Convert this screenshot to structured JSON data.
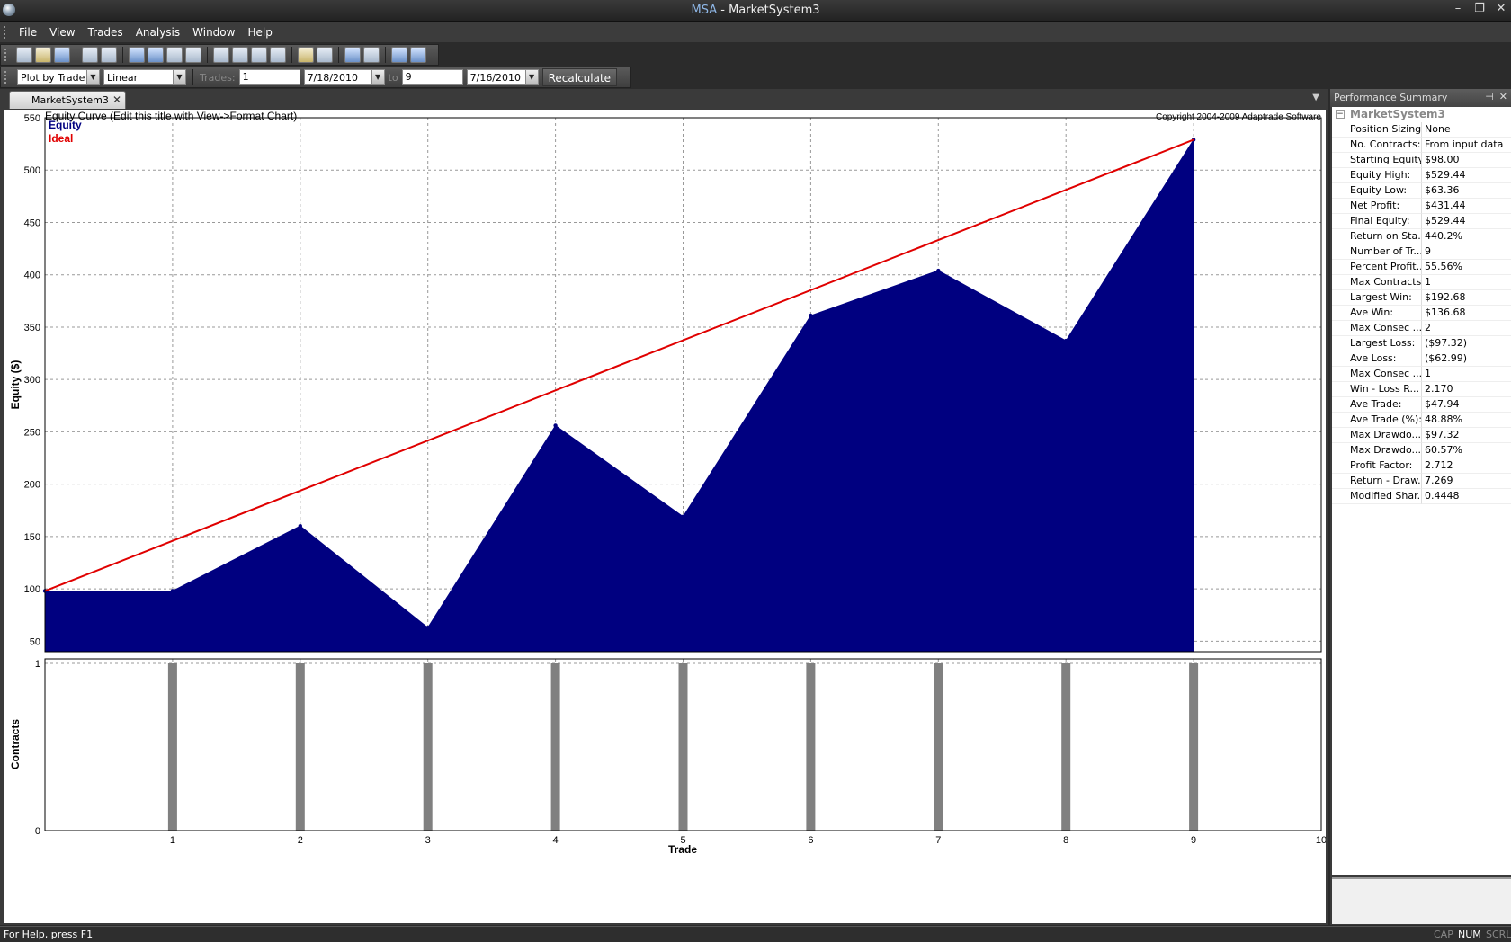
{
  "window": {
    "app": "MSA",
    "sep": " - ",
    "doc": "MarketSystem3"
  },
  "menu": [
    "File",
    "View",
    "Trades",
    "Analysis",
    "Window",
    "Help"
  ],
  "toolbar2": {
    "plot_mode": "Plot by Trade",
    "scale": "Linear",
    "trades_label": "Trades:",
    "trades_from": "1",
    "date_from": "7/18/2010",
    "to_label": "to",
    "trades_to": "9",
    "date_to": "7/16/2010",
    "recalc": "Recalculate"
  },
  "tab": {
    "label": "MarketSystem3",
    "close": "✕"
  },
  "chart_data": {
    "type": "area",
    "title": "Equity Curve (Edit this title with View->Format Chart)",
    "copyright": "Copyright 2004-2009 Adaptrade Software",
    "ylabel": "Equity ($)",
    "xlabel": "Trade",
    "ylim": [
      40,
      550
    ],
    "y_ticks": [
      550,
      500,
      450,
      400,
      350,
      300,
      250,
      200,
      150,
      100,
      50
    ],
    "x_ticks": [
      1,
      2,
      3,
      4,
      5,
      6,
      7,
      8,
      9,
      10
    ],
    "xlim": [
      0,
      10
    ],
    "grid": true,
    "legend_position": "top-left",
    "series": [
      {
        "name": "Equity",
        "color": "#000080",
        "x": [
          0,
          1,
          2,
          3,
          4,
          5,
          6,
          7,
          8,
          9
        ],
        "values": [
          98,
          98,
          160,
          63,
          256,
          169,
          361,
          404,
          337,
          529
        ]
      },
      {
        "name": "Ideal",
        "color": "#e00000",
        "x": [
          0,
          9
        ],
        "values": [
          98,
          529
        ]
      }
    ],
    "contracts": {
      "ylabel": "Contracts",
      "ylim": [
        0,
        1
      ],
      "y_ticks": [
        1,
        0
      ],
      "color": "#808080",
      "x": [
        1,
        2,
        3,
        4,
        5,
        6,
        7,
        8,
        9
      ],
      "values": [
        1,
        1,
        1,
        1,
        1,
        1,
        1,
        1,
        1
      ]
    }
  },
  "perf": {
    "title": "Performance Summary",
    "root": "MarketSystem3",
    "rows": [
      [
        "Position Sizing:",
        "None"
      ],
      [
        "No. Contracts:",
        "From input data"
      ],
      [
        "Starting Equity:",
        "$98.00"
      ],
      [
        "Equity High:",
        "$529.44"
      ],
      [
        "Equity Low:",
        "$63.36"
      ],
      [
        "Net Profit:",
        "$431.44"
      ],
      [
        "Final Equity:",
        "$529.44"
      ],
      [
        "Return on Sta...",
        "440.2%"
      ],
      [
        "Number of Tr...",
        "9"
      ],
      [
        "Percent Profit...",
        "55.56%"
      ],
      [
        "Max Contracts:",
        "1"
      ],
      [
        "Largest Win:",
        "$192.68"
      ],
      [
        "Ave Win:",
        "$136.68"
      ],
      [
        "Max Consec ...",
        "2"
      ],
      [
        "Largest Loss:",
        "($97.32)"
      ],
      [
        "Ave Loss:",
        "($62.99)"
      ],
      [
        "Max Consec ...",
        "1"
      ],
      [
        "Win - Loss R...",
        "2.170"
      ],
      [
        "Ave Trade:",
        "$47.94"
      ],
      [
        "Ave Trade (%):",
        "48.88%"
      ],
      [
        "Max Drawdo...",
        "$97.32"
      ],
      [
        "Max Drawdo...",
        "60.57%"
      ],
      [
        "Profit Factor:",
        "2.712"
      ],
      [
        "Return - Draw...",
        "7.269"
      ],
      [
        "Modified Shar...",
        "0.4448"
      ]
    ]
  },
  "status": {
    "text": "For Help, press F1",
    "cap": "CAP",
    "num": "NUM",
    "scrl": "SCRL"
  }
}
